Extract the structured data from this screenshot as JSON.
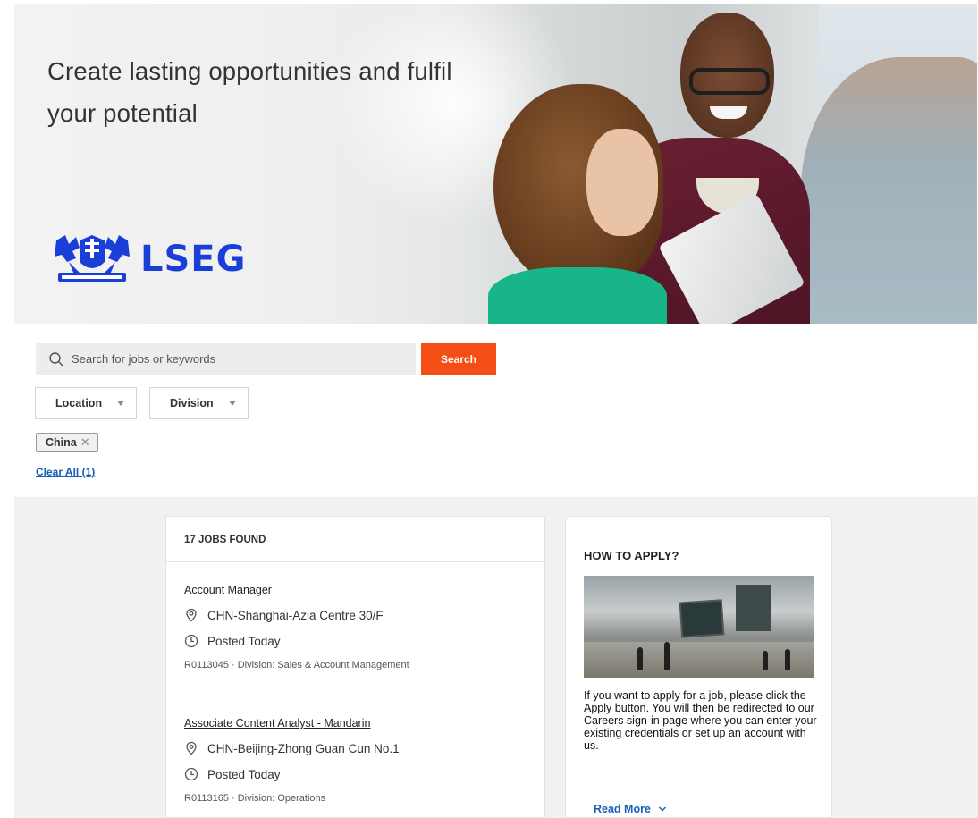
{
  "hero": {
    "title": "Create lasting opportunities and fulfil your potential",
    "logo_text": "LSEG"
  },
  "search": {
    "placeholder": "Search for jobs or keywords",
    "button_label": "Search"
  },
  "filters": {
    "location_label": "Location",
    "division_label": "Division",
    "active_chip": "China",
    "clear_all_label": "Clear All (1)"
  },
  "jobs": {
    "count_label": "17 JOBS FOUND",
    "items": [
      {
        "title": "Account Manager",
        "location": "CHN-Shanghai-Azia Centre 30/F",
        "posted": "Posted Today",
        "meta": "R0113045 · Division: Sales & Account Management"
      },
      {
        "title": "Associate Content Analyst - Mandarin",
        "location": "CHN-Beijing-Zhong Guan Cun No.1",
        "posted": "Posted Today",
        "meta": "R0113165 · Division: Operations"
      }
    ]
  },
  "how_to_apply": {
    "title": "HOW TO APPLY?",
    "body": "If you want to apply for a job, please click the Apply button. You will then be redirected to our Careers sign-in page where you can enter your existing credentials or set up an account with us.",
    "read_more_label": "Read More"
  },
  "colors": {
    "brand_blue": "#1a3fd8",
    "search_button": "#f54e15",
    "link": "#1a5fb4"
  },
  "icons": [
    "search-icon",
    "caret-down-icon",
    "close-icon",
    "location-pin-icon",
    "clock-icon",
    "chevron-down-icon",
    "lseg-crest-icon"
  ]
}
